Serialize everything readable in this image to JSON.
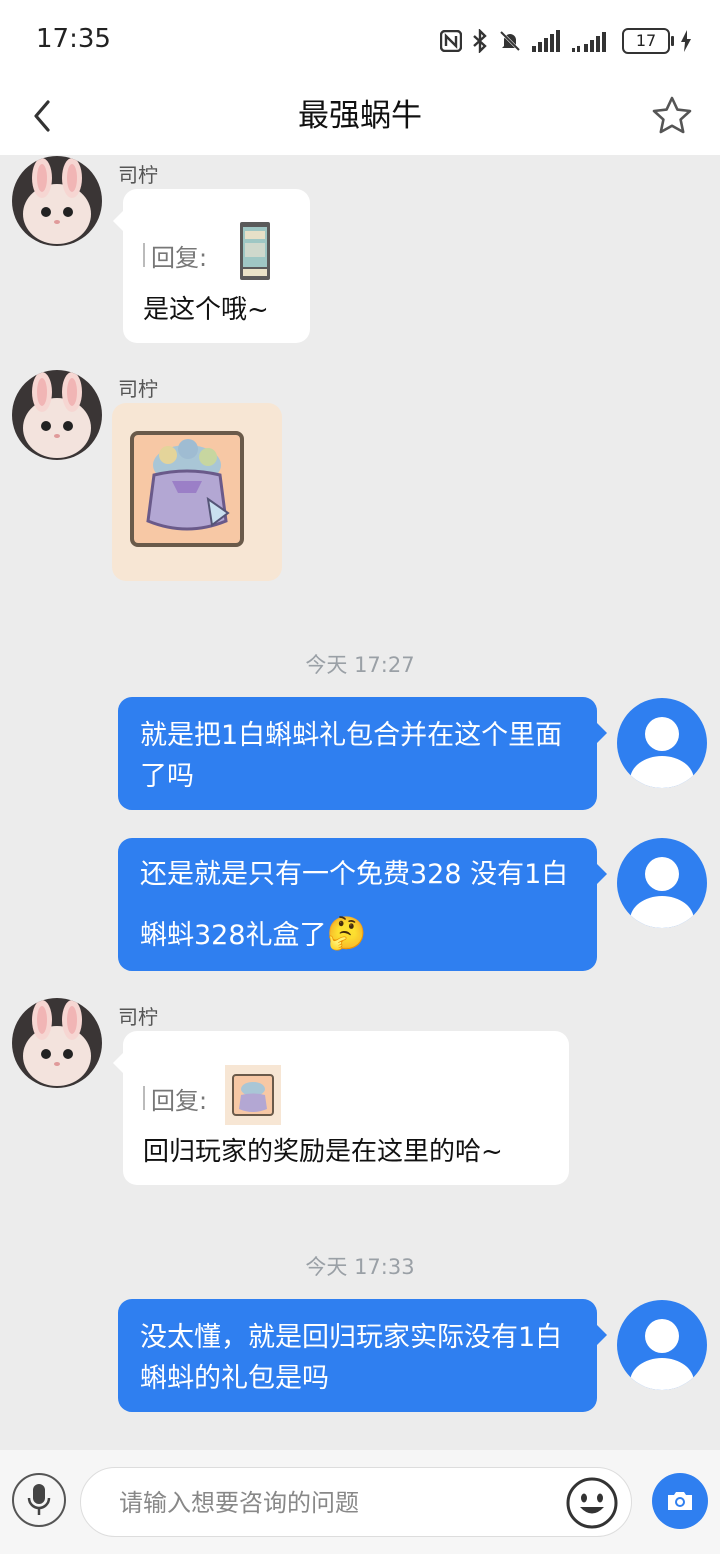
{
  "status_bar": {
    "time": "17:35",
    "battery": "17"
  },
  "header": {
    "title": "最强蜗牛",
    "back_icon": "chevron-left-icon",
    "star_icon": "star-outline-icon"
  },
  "messages": [
    {
      "type": "incoming-reply",
      "sender": "司柠",
      "reply_label": "回复:",
      "text": "是这个哦~"
    },
    {
      "type": "incoming-image",
      "sender": "司柠"
    },
    {
      "type": "timestamp",
      "text": "今天 17:27"
    },
    {
      "type": "outgoing",
      "text": "就是把1白蝌蚪礼包合并在这个里面了吗"
    },
    {
      "type": "outgoing",
      "text": "还是就是只有一个免费328 没有1白蝌蚪328礼盒了",
      "emoji": "🤔"
    },
    {
      "type": "incoming-reply",
      "sender": "司柠",
      "reply_label": "回复:",
      "text": "回归玩家的奖励是在这里的哈~"
    },
    {
      "type": "timestamp",
      "text": "今天 17:33"
    },
    {
      "type": "outgoing",
      "text": "没太懂，就是回归玩家实际没有1白蝌蚪的礼包是吗"
    }
  ],
  "input_bar": {
    "placeholder": "请输入想要咨询的问题",
    "mic_icon": "microphone-icon",
    "emoji_icon": "emoji-smile-icon",
    "camera_icon": "camera-icon"
  },
  "colors": {
    "accent": "#2f7ff0",
    "background": "#ececec",
    "bubble_in": "#ffffff"
  }
}
